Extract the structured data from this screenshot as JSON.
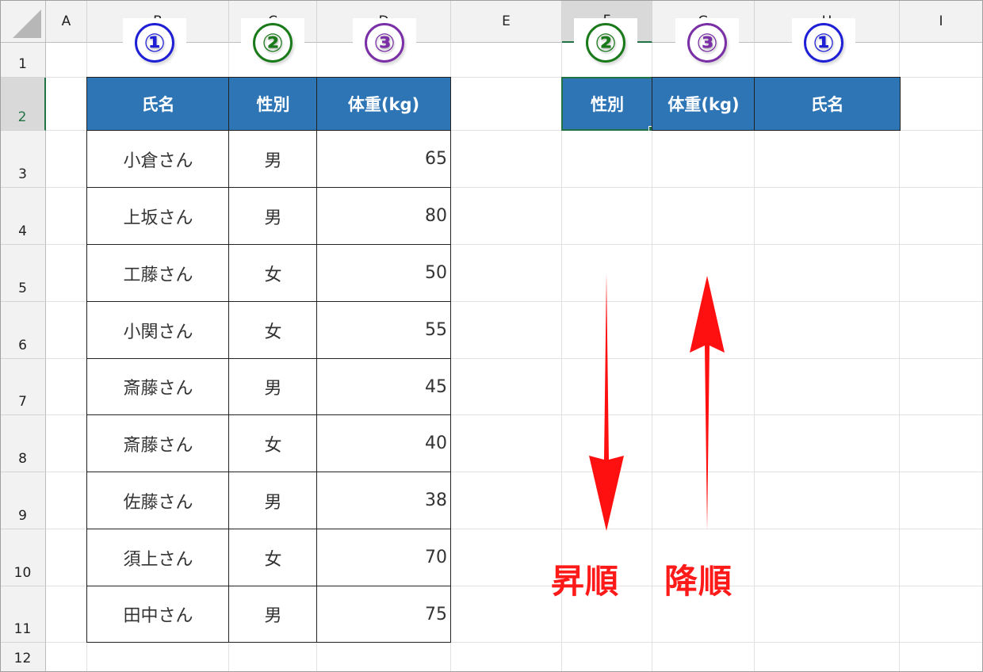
{
  "columns": [
    "A",
    "B",
    "C",
    "D",
    "E",
    "F",
    "G",
    "H",
    "I"
  ],
  "rows": [
    "1",
    "2",
    "3",
    "4",
    "5",
    "6",
    "7",
    "8",
    "9",
    "10",
    "11",
    "12"
  ],
  "left_table": {
    "headers": [
      "氏名",
      "性別",
      "体重(kg)"
    ],
    "rows": [
      [
        "小倉さん",
        "男",
        "65"
      ],
      [
        "上坂さん",
        "男",
        "80"
      ],
      [
        "工藤さん",
        "女",
        "50"
      ],
      [
        "小関さん",
        "女",
        "55"
      ],
      [
        "斎藤さん",
        "男",
        "45"
      ],
      [
        "斎藤さん",
        "女",
        "40"
      ],
      [
        "佐藤さん",
        "男",
        "38"
      ],
      [
        "須上さん",
        "女",
        "70"
      ],
      [
        "田中さん",
        "男",
        "75"
      ]
    ]
  },
  "right_table": {
    "headers": [
      "性別",
      "体重(kg)",
      "氏名"
    ]
  },
  "badges": {
    "left": [
      "①",
      "②",
      "③"
    ],
    "right": [
      "②",
      "③",
      "①"
    ]
  },
  "annotations": {
    "ascending": "昇順",
    "descending": "降順"
  },
  "colors": {
    "header_fill": "#2e75b6",
    "badge_1": "#1f1fd6",
    "badge_2": "#1a7a1a",
    "badge_3": "#7a2fa6",
    "annotation": "#ff1a1a",
    "selection": "#217346"
  }
}
